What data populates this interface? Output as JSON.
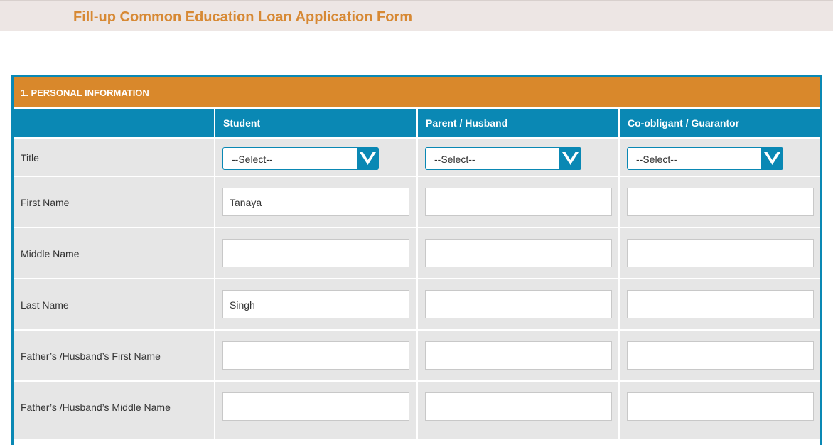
{
  "page": {
    "title": "Fill-up Common Education Loan Application Form"
  },
  "section": {
    "title": "1. PERSONAL INFORMATION"
  },
  "columns": [
    "Student",
    "Parent / Husband",
    "Co-obligant / Guarantor"
  ],
  "title_row": {
    "label": "Title",
    "selects": [
      "--Select--",
      "--Select--",
      "--Select--"
    ]
  },
  "rows": [
    {
      "label": "First Name",
      "values": [
        "Tanaya",
        "",
        ""
      ]
    },
    {
      "label": "Middle Name",
      "values": [
        "",
        "",
        ""
      ]
    },
    {
      "label": "Last Name",
      "values": [
        "Singh",
        "",
        ""
      ]
    },
    {
      "label": "Father’s /Husband’s First Name",
      "values": [
        "",
        "",
        ""
      ]
    },
    {
      "label": "Father’s /Husband’s Middle Name",
      "values": [
        "",
        "",
        ""
      ]
    }
  ],
  "colors": {
    "accent_blue": "#0a88b4",
    "accent_orange": "#d9882b",
    "title_orange": "#d78934",
    "cell_gray": "#e6e6e6"
  },
  "icons": {
    "select_arrow": "chevron-down-icon"
  }
}
